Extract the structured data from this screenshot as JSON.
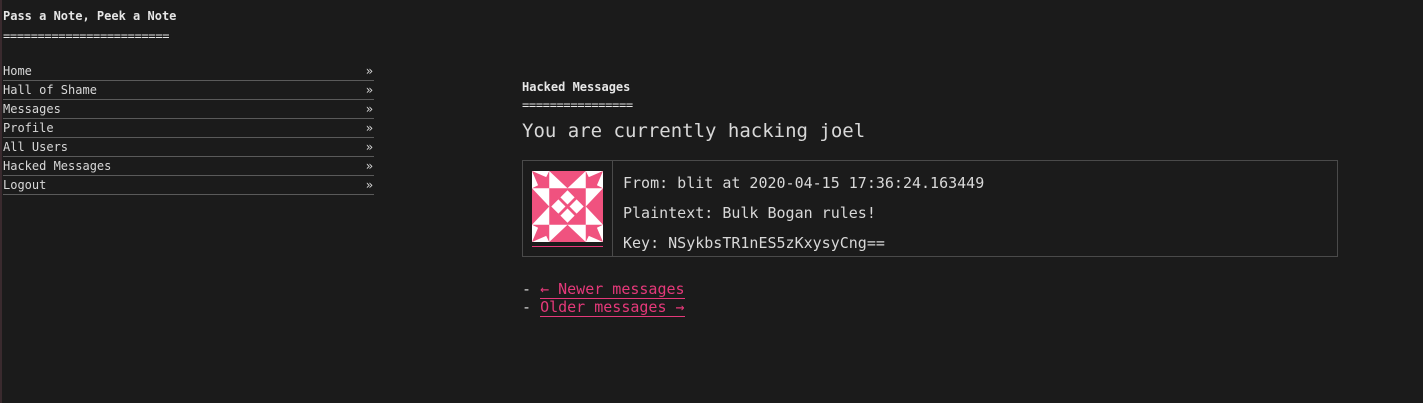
{
  "site": {
    "title": "Pass a Note, Peek a Note",
    "title_underline": "========================"
  },
  "nav": {
    "arrow": "»",
    "items": [
      {
        "label": "Home"
      },
      {
        "label": "Hall of Shame"
      },
      {
        "label": "Messages"
      },
      {
        "label": "Profile"
      },
      {
        "label": "All Users"
      },
      {
        "label": "Hacked Messages"
      },
      {
        "label": "Logout"
      }
    ]
  },
  "main": {
    "section_title": "Hacked Messages",
    "section_underline": "================",
    "hacking_status": "You are currently hacking joel",
    "message": {
      "avatar_icon": "identicon-avatar",
      "avatar_color": "#f0527f",
      "from_line": "From: blit at 2020-04-15 17:36:24.163449",
      "plaintext_line": "Plaintext: Bulk Bogan rules!",
      "key_line": "Key: NSykbsTR1nES5zKxysyCng=="
    },
    "pager": {
      "prefix": "-",
      "newer_label": "← Newer messages",
      "older_label": "Older messages →"
    }
  },
  "colors": {
    "background": "#1b1b1b",
    "text": "#d8d8d8",
    "link": "#e5397a"
  }
}
